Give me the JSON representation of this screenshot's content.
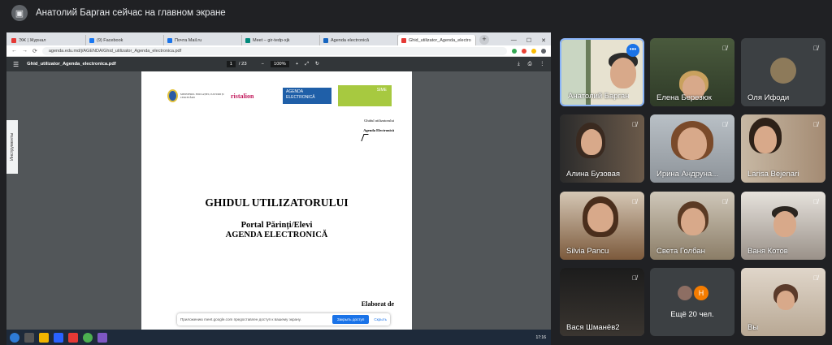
{
  "meeting": {
    "presenter_banner": "Анатолий Барган сейчас на главном экране"
  },
  "browser": {
    "tabs": [
      {
        "label": "ЭЖ | Журнал",
        "color": "#e53935"
      },
      {
        "label": "(9) Facebook",
        "color": "#1877f2"
      },
      {
        "label": "Почта Mail.ru",
        "color": "#1a73e8"
      },
      {
        "label": "Meet – gir-tedp-xjk",
        "color": "#00897b"
      },
      {
        "label": "Agenda electronică",
        "color": "#1565c0"
      },
      {
        "label": "Ghid_utilizator_Agenda_electro",
        "color": "#e53935"
      }
    ],
    "url": "agenda.edu.md/j/AGENDA/Ghid_utilizator_Agenda_electronica.pdf",
    "newtab_icon": "+"
  },
  "pdf": {
    "filename": "Ghid_utilizator_Agenda_electronica.pdf",
    "page_current": "1",
    "page_total": "/ 23",
    "zoom": "100%",
    "side_tab": "Инструменты"
  },
  "document": {
    "logo_ministry": "MINISTERUL EDUCAȚIEI, CULTURII ȘI CERCETĂRII",
    "logo_ristalion": "ristalion",
    "logo_agenda": "AGENDA ELECTRONICĂ",
    "logo_sime": "SIME",
    "header_line1": "Ghidul utilizatorului",
    "header_line2": "Agenda Electronică",
    "title": "GHIDUL UTILIZATORULUI",
    "subtitle1": "Portal Părinți/Elevi",
    "subtitle2": "AGENDA ELECTRONICĂ",
    "elaborat": "Elaborat de"
  },
  "share_bar": {
    "message": "Приложению meet.google.com предоставлен доступ к вашему экрану.",
    "stop_label": "Закрыть доступ",
    "hide_label": "Скрыть"
  },
  "taskbar": {
    "time": "17:16"
  },
  "participants": [
    {
      "name": "Анатолий Барган",
      "muted": false,
      "active": true
    },
    {
      "name": "Елена Березюк",
      "muted": true
    },
    {
      "name": "Оля Ифоди",
      "muted": true
    },
    {
      "name": "Алина Бузовая",
      "muted": true
    },
    {
      "name": "Ирина Андруна...",
      "muted": true
    },
    {
      "name": "Larisa Bejenari",
      "muted": true
    },
    {
      "name": "Silvia Pancu",
      "muted": true
    },
    {
      "name": "Света Голбан",
      "muted": true
    },
    {
      "name": "Ваня Котов",
      "muted": true
    },
    {
      "name": "Вася Шманёв2",
      "muted": true
    },
    {
      "name": "Ещё 20 чел.",
      "avatar_letter": "Н"
    },
    {
      "name": "Вы",
      "muted": true
    }
  ],
  "icons": {
    "mic_off": "mic-off-icon",
    "more": "more-options-icon"
  }
}
